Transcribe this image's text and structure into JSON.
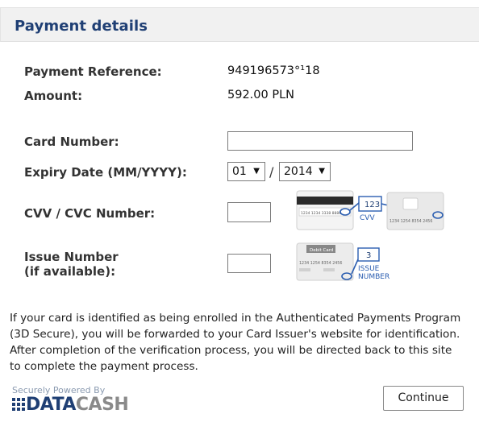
{
  "header": {
    "title": "Payment details"
  },
  "fields": {
    "payment_reference": {
      "label": "Payment Reference:",
      "value": "949196573°¹18"
    },
    "amount": {
      "label": "Amount:",
      "value": "592.00 PLN"
    },
    "card_number": {
      "label": "Card Number:",
      "value": ""
    },
    "expiry": {
      "label": "Expiry Date (MM/YYYY):",
      "month": "01",
      "separator": "/",
      "year": "2014"
    },
    "cvv": {
      "label": "CVV / CVC Number:",
      "value": "",
      "example_code": "123",
      "caption": "CVV",
      "card_digits": "1234 1254 8354 2456",
      "strip_digits": "1234 1234 3338 8888"
    },
    "issue_number": {
      "label_line1": "Issue Number",
      "label_line2": "(if available):",
      "value": "",
      "example_code": "3",
      "caption_line1": "ISSUE",
      "caption_line2": "NUMBER",
      "card_title": "Debit Card",
      "card_digits": "1234 1254 8354 2456"
    }
  },
  "info_text": "If your card is identified as being enrolled in the Authenticated Payments Program (3D Secure), you will be forwarded to your Card Issuer's website for identification. After completion of the verification process, you will be directed back to this site to complete the payment process.",
  "continue_label": "Continue",
  "logo": {
    "tagline": "Securely Powered By",
    "brand_data": "DATA",
    "brand_cash": "CASH"
  },
  "colors": {
    "brand_blue": "#1f3f74",
    "header_bg": "#f1f1f1",
    "callout_blue": "#2a5db0"
  }
}
